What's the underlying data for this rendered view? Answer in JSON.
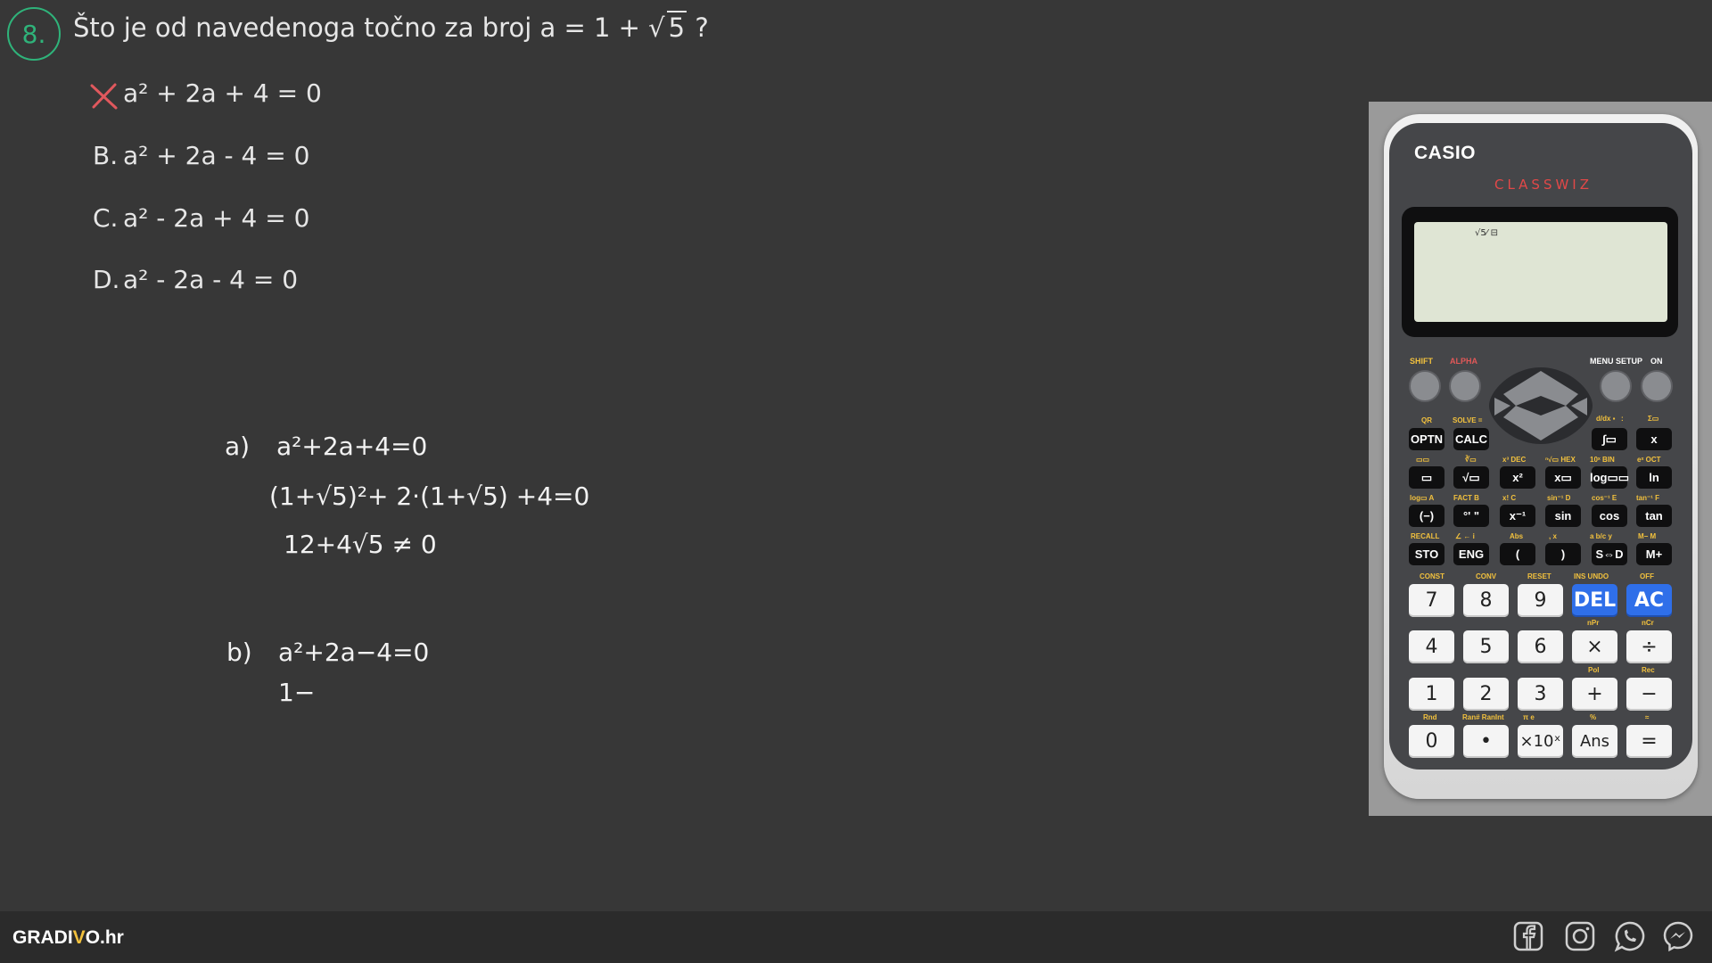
{
  "question": {
    "number": "8.",
    "text_prefix": "Što je od navedenoga točno za broj a = 1 + ",
    "radicand": "5",
    "text_suffix": " ?"
  },
  "options": [
    {
      "label": "A.",
      "text": "a² + 2a + 4 = 0",
      "marked": true
    },
    {
      "label": "B.",
      "text": "a² + 2a - 4 = 0"
    },
    {
      "label": "C.",
      "text": "a² - 2a + 4 = 0"
    },
    {
      "label": "D.",
      "text": "a² - 2a - 4 = 0"
    }
  ],
  "handwriting": {
    "a_label": "a)",
    "a_line1": "a²+2a+4=0",
    "a_line2": "(1+√5)²+ 2·(1+√5) +4=0",
    "a_line3": "12+4√5 ≠ 0",
    "b_label": "b)",
    "b_line1": "a²+2a−4=0",
    "b_line2": "1−"
  },
  "calculator": {
    "brand": "CASIO",
    "model": "CLASSWIZ",
    "indicator": "√5⁄ ⊟",
    "top_labels": {
      "shift": "SHIFT",
      "alpha": "ALPHA",
      "menu": "MENU SETUP",
      "on": "ON"
    },
    "func_keys": [
      [
        "OPTN",
        "CALC",
        "∫▭",
        "x"
      ],
      [
        "▭",
        "√▭",
        "x²",
        "x▭",
        "log▭▭",
        "ln"
      ],
      [
        "(−)",
        "°' \"",
        "x⁻¹",
        "sin",
        "cos",
        "tan"
      ],
      [
        "STO",
        "ENG",
        "(",
        ")",
        "S⇔D",
        "M+"
      ]
    ],
    "shift_labels": {
      "row1": [
        "QR",
        "SOLVE =",
        "d/dx ▪",
        ":",
        "Σ▭"
      ],
      "row2": [
        "▭▭",
        "∛▭",
        "x³ DEC",
        "ⁿ√▭ HEX",
        "10ˣ BIN",
        "eˣ OCT"
      ],
      "row3": [
        "log▭ A",
        "FACT B",
        "x! C",
        "sin⁻¹ D",
        "cos⁻¹ E",
        "tan⁻¹ F"
      ],
      "row4": [
        "RECALL",
        "∠ ← i",
        "Abs",
        ", x",
        "a b/c y",
        "M− M"
      ]
    },
    "num_labels": {
      "row1": [
        "CONST",
        "CONV",
        "RESET",
        "INS UNDO",
        "OFF"
      ],
      "row2": [
        "",
        "",
        "",
        "nPr",
        "nCr"
      ],
      "row3": [
        "",
        "",
        "",
        "Pol",
        "Rec"
      ],
      "row4": [
        "Rnd",
        "Ran# RanInt",
        "π e",
        "%",
        "≈"
      ]
    },
    "num_keys": [
      [
        "7",
        "8",
        "9",
        "DEL",
        "AC"
      ],
      [
        "4",
        "5",
        "6",
        "×",
        "÷"
      ],
      [
        "1",
        "2",
        "3",
        "+",
        "−"
      ],
      [
        "0",
        "•",
        "×10ˣ",
        "Ans",
        "="
      ]
    ]
  },
  "footer": {
    "logo_prefix": "GRADI",
    "logo_v": "V",
    "logo_suffix": "O.hr"
  },
  "social_icons": [
    "facebook-icon",
    "instagram-icon",
    "whatsapp-icon",
    "messenger-icon"
  ],
  "colors": {
    "background": "#373737",
    "accent_green": "#2fb37a",
    "mark_red": "#e0585d",
    "calc_blue": "#2f6fe9"
  }
}
